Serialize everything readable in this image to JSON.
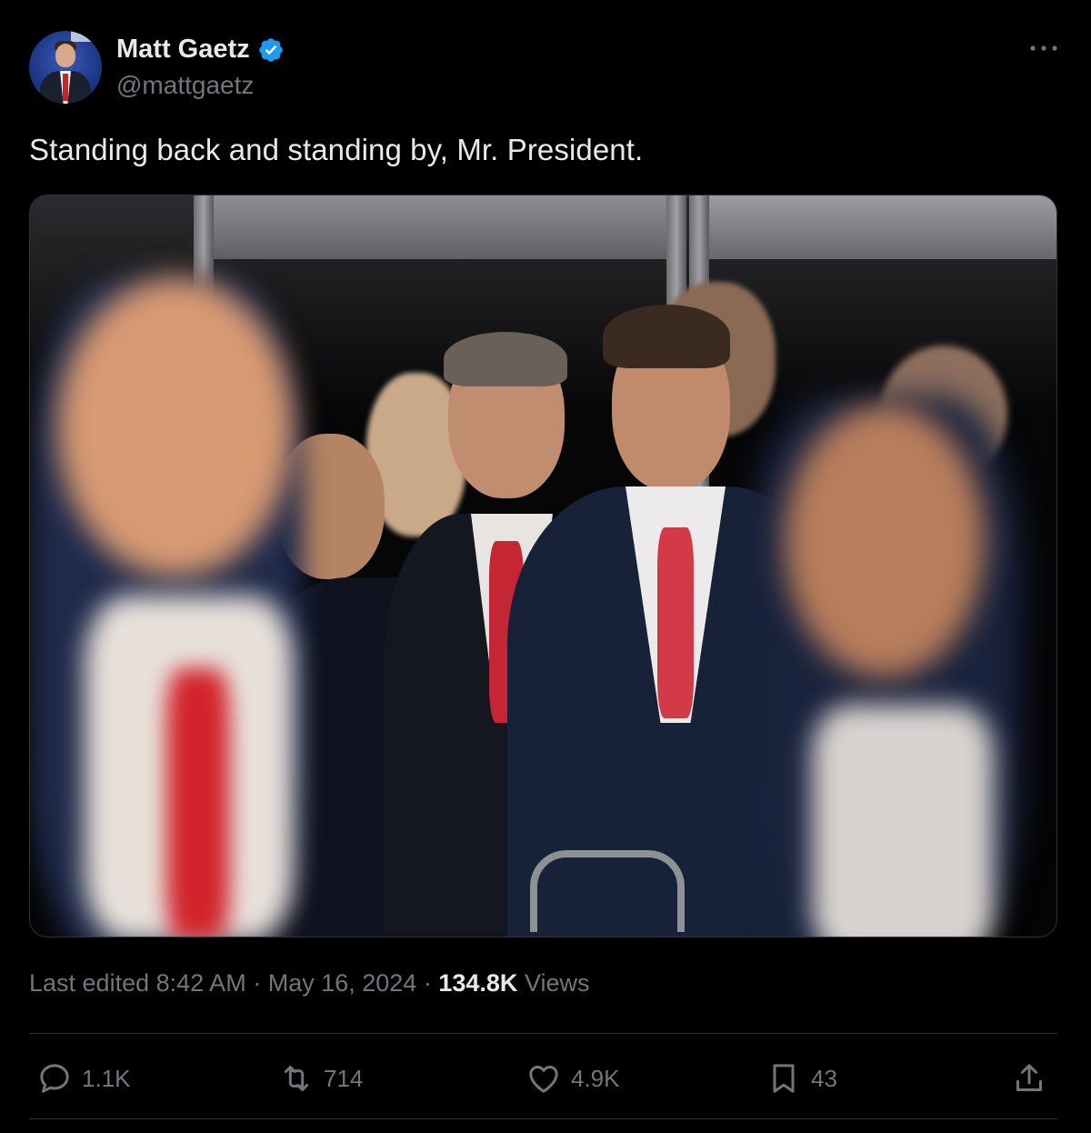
{
  "author": {
    "name": "Matt Gaetz",
    "handle": "@mattgaetz",
    "verified_icon": "verified-badge-icon",
    "avatar_icon": "profile-avatar"
  },
  "tweet": {
    "text": "Standing back and standing by, Mr. President.",
    "media_alt": "photo"
  },
  "meta": {
    "edited_label": "Last edited",
    "time": "8:42 AM",
    "separator": "·",
    "date": "May 16, 2024",
    "views_count": "134.8K",
    "views_label": "Views"
  },
  "actions": {
    "reply_count": "1.1K",
    "retweet_count": "714",
    "like_count": "4.9K",
    "bookmark_count": "43"
  },
  "colors": {
    "background": "#000000",
    "text_primary": "#e7e9ea",
    "text_secondary": "#71767b",
    "verified_blue": "#1d9bf0",
    "divider": "#2f3336"
  }
}
